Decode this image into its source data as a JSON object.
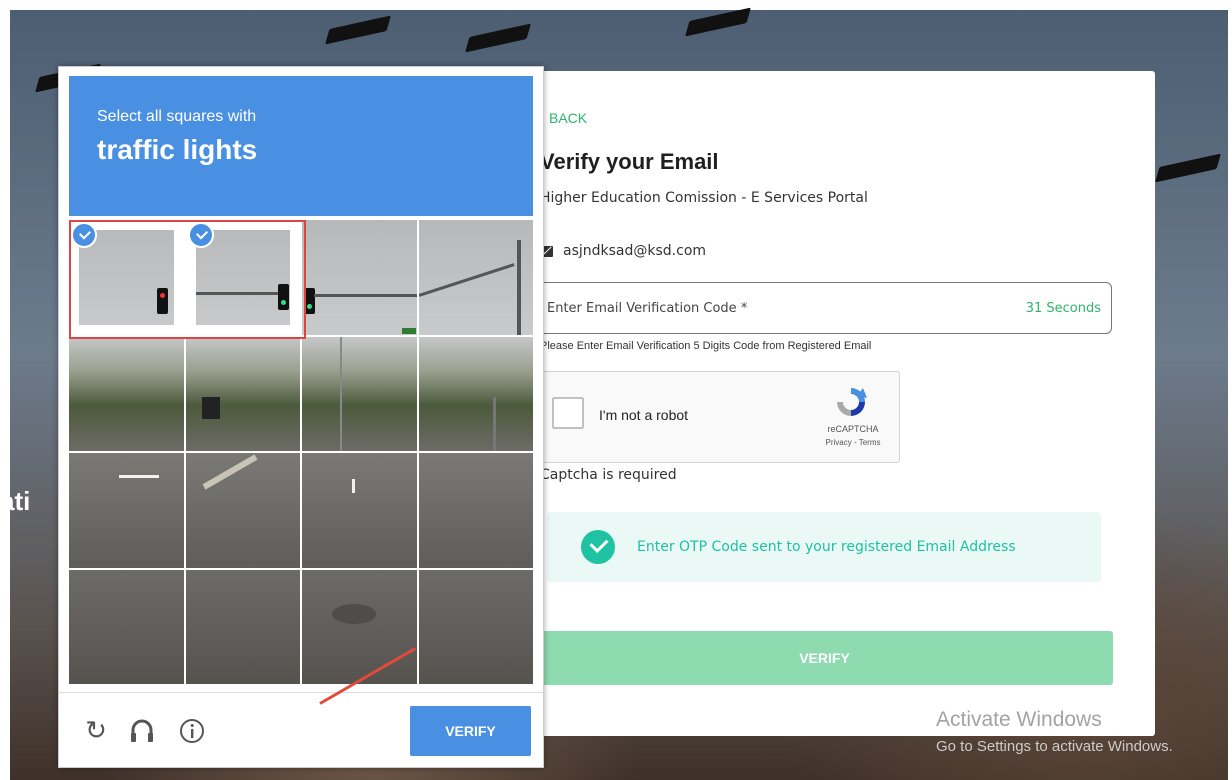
{
  "side_text": "ati",
  "form": {
    "back_label": "BACK",
    "title": "Verify your Email",
    "subtitle": "Higher Education Comission - E Services Portal",
    "email": "asjndksad@ksd.com",
    "code_label": "Enter Email Verification Code *",
    "timer": "31 Seconds",
    "helper": "Please Enter Email Verification 5 Digits Code from Registered Email",
    "recaptcha": {
      "label": "I'm not a robot",
      "brand": "reCAPTCHA",
      "links": "Privacy - Terms"
    },
    "captcha_required": "Captcha is required",
    "otp_message": "Enter OTP Code sent to your registered Email Address",
    "verify_label": "VERIFY"
  },
  "challenge": {
    "instruction": "Select all squares with",
    "target": "traffic lights",
    "verify_label": "VERIFY",
    "selected_tiles": [
      0,
      1
    ],
    "footer_icons": [
      "reload-icon",
      "audio-icon",
      "info-icon"
    ]
  },
  "watermark": {
    "line1": "Activate Windows",
    "line2": "Go to Settings to activate Windows."
  },
  "colors": {
    "accent_green": "#2fb36e",
    "teal": "#1fc2a2",
    "recaptcha_blue": "#4a90e2",
    "verify_green": "#8ddbaf",
    "selection_red": "#d44444"
  }
}
